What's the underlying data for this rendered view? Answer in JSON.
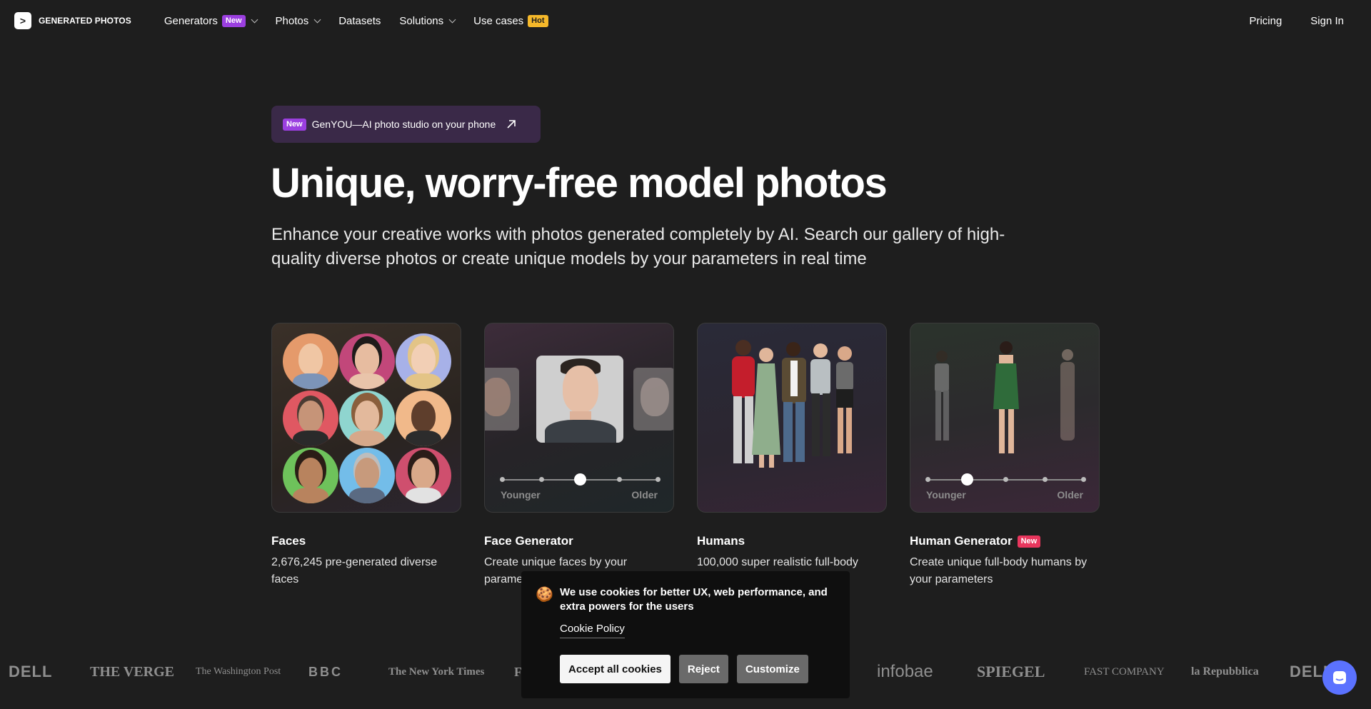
{
  "nav": {
    "logo_text": "GENERATED PHOTOS",
    "items": [
      {
        "label": "Generators",
        "badge": "New",
        "dropdown": true
      },
      {
        "label": "Photos",
        "dropdown": true
      },
      {
        "label": "Datasets"
      },
      {
        "label": "Solutions",
        "dropdown": true
      },
      {
        "label": "Use cases",
        "badge": "Hot"
      }
    ],
    "pricing": "Pricing",
    "signin": "Sign In"
  },
  "promo": {
    "badge": "New",
    "text": "GenYOU—AI photo studio on your phone"
  },
  "hero": {
    "title": "Unique, worry-free model photos",
    "lead": "Enhance your creative works with photos generated completely by AI. Search our gallery of high-quality diverse photos or create unique models by your parameters in real time"
  },
  "cards": [
    {
      "title": "Faces",
      "desc": "2,676,245 pre-generated diverse faces"
    },
    {
      "title": "Face Generator",
      "desc": "Create unique faces by your parameters",
      "slider_left": "Younger",
      "slider_right": "Older",
      "slider_level": 0.5
    },
    {
      "title": "Humans",
      "desc": "100,000 super realistic full-body images"
    },
    {
      "title": "Human Generator",
      "badge": "New",
      "desc": "Create unique full-body humans by your parameters",
      "slider_left": "Younger",
      "slider_right": "Older",
      "slider_level": 0.25
    }
  ],
  "logos": [
    "DELL",
    "THE VERGE",
    "The Washington Post",
    "BBC",
    "The New York Times",
    "Fo",
    "infobae",
    "SPIEGEL",
    "FAST COMPANY",
    "la Repubblica",
    "DELL"
  ],
  "cookie": {
    "text": "We use cookies for better UX, web performance, and extra powers for the users",
    "link": "Cookie Policy",
    "accept": "Accept all cookies",
    "reject": "Reject",
    "customize": "Customize"
  },
  "colors": {
    "background": "#1e1e1e",
    "badge_new": "#9b3fe0",
    "badge_hot": "#f5b82a",
    "badge_new_pink": "#e8365d",
    "chat": "#5b72ff"
  }
}
